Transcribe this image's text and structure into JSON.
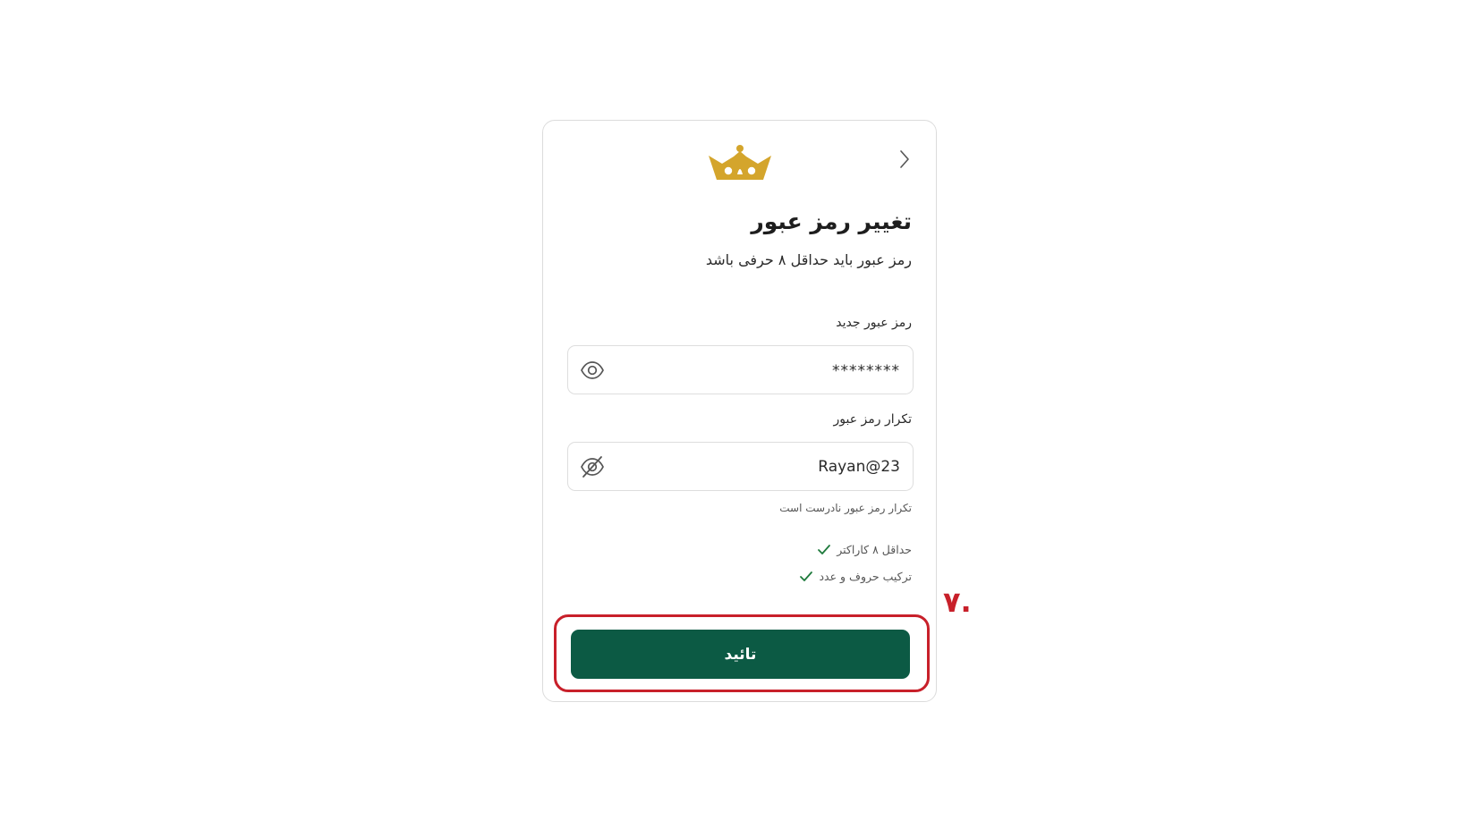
{
  "header": {
    "back_icon": "chevron-right-icon",
    "logo": "crown-logo",
    "logo_color": "#d4a52c"
  },
  "title": "تغییر رمز عبور",
  "subtitle": "رمز عبور باید حداقل ۸ حرفی باشد",
  "new_password": {
    "label": "رمز عبور جدید",
    "value": "********",
    "icon": "eye-icon"
  },
  "repeat_password": {
    "label": "تکرار رمز عبور",
    "value": "Rayan@23",
    "icon": "eye-off-icon"
  },
  "error_message": "تکرار رمز عبور نادرست است",
  "requirements": [
    {
      "label": "حداقل ۸ کاراکتر",
      "met": true
    },
    {
      "label": "ترکیب حروف و عدد",
      "met": true
    }
  ],
  "submit_label": "تائید",
  "submit_color": "#0c5a44",
  "step_marker": "۷.",
  "highlight_color": "#c8202a"
}
